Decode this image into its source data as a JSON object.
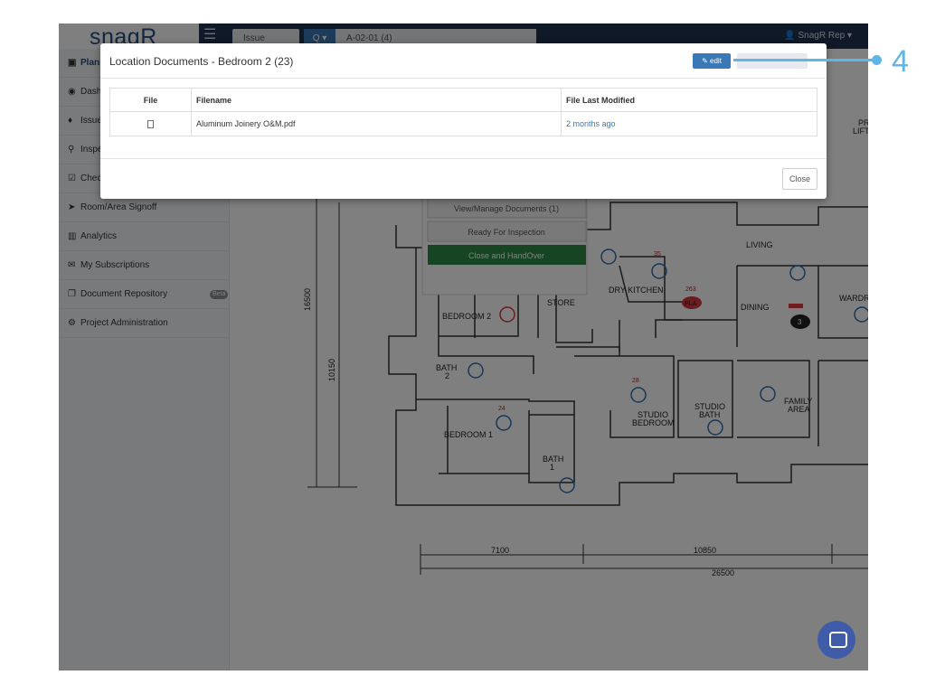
{
  "topbar": {
    "logo": "snagR",
    "search_type": "Issue",
    "search_button": "Q ▾",
    "search_value": "A-02-01 (4)",
    "user": "SnagR Rep ▾"
  },
  "sidebar": {
    "items": [
      {
        "label": "Plans",
        "icon": "image-icon"
      },
      {
        "label": "Dashboard",
        "icon": "dashboard-icon"
      },
      {
        "label": "Issues",
        "icon": "map-marker-icon"
      },
      {
        "label": "Inspections",
        "icon": "search-icon"
      },
      {
        "label": "Checklists",
        "icon": "checkbox-icon"
      },
      {
        "label": "Room/Area Signoff",
        "icon": "location-arrow-icon"
      },
      {
        "label": "Analytics",
        "icon": "bar-chart-icon"
      },
      {
        "label": "My Subscriptions",
        "icon": "envelope-icon"
      },
      {
        "label": "Document Repository",
        "icon": "copy-icon"
      },
      {
        "label": "Project Administration",
        "icon": "cogs-icon"
      }
    ],
    "beta_badge": "Beta"
  },
  "plan": {
    "popup_buttons": [
      "View/Manage Documents (1)",
      "Ready For Inspection",
      "Close and HandOver"
    ],
    "labels": {
      "living": "LIVING",
      "dry_kitchen": "DRY KITCHEN",
      "dining": "DINING",
      "bedroom2": "BEDROOM 2",
      "store": "STORE",
      "bath2_a": "BATH",
      "bath2_b": "2",
      "bedroom1": "BEDROOM 1",
      "bath1_a": "BATH",
      "bath1_b": "1",
      "studio_bedroom_a": "STUDIO",
      "studio_bedroom_b": "BEDROOM",
      "studio_bath_a": "STUDIO",
      "studio_bath_b": "BATH",
      "family_area_a": "FAMILY",
      "family_area_b": "AREA",
      "wardrobe": "WARDR",
      "pr_lift_a": "PR",
      "pr_lift_b": "LIFT",
      "dim_16500": "16500",
      "dim_10150": "10150",
      "dim_7100": "7100",
      "dim_10850": "10850",
      "dim_26500": "26500",
      "marker_35": "35",
      "marker_263": "263",
      "marker_28": "28",
      "marker_24": "24",
      "marker_3": "3",
      "marker_pla": "PLA"
    }
  },
  "modal": {
    "title": "Location Documents - Bedroom 2 (23)",
    "edit_label": "edit",
    "columns": [
      "File",
      "Filename",
      "File Last Modified"
    ],
    "rows": [
      {
        "filename": "Aluminum Joinery O&M.pdf",
        "modified": "2 months ago"
      }
    ],
    "close_label": "Close"
  },
  "callout": {
    "number": "4"
  },
  "colors": {
    "navbar": "#20324f",
    "accent": "#3a78b8",
    "handover_green": "#2e8b46",
    "callout": "#5fb6e6",
    "issue_red": "#d9363e"
  }
}
